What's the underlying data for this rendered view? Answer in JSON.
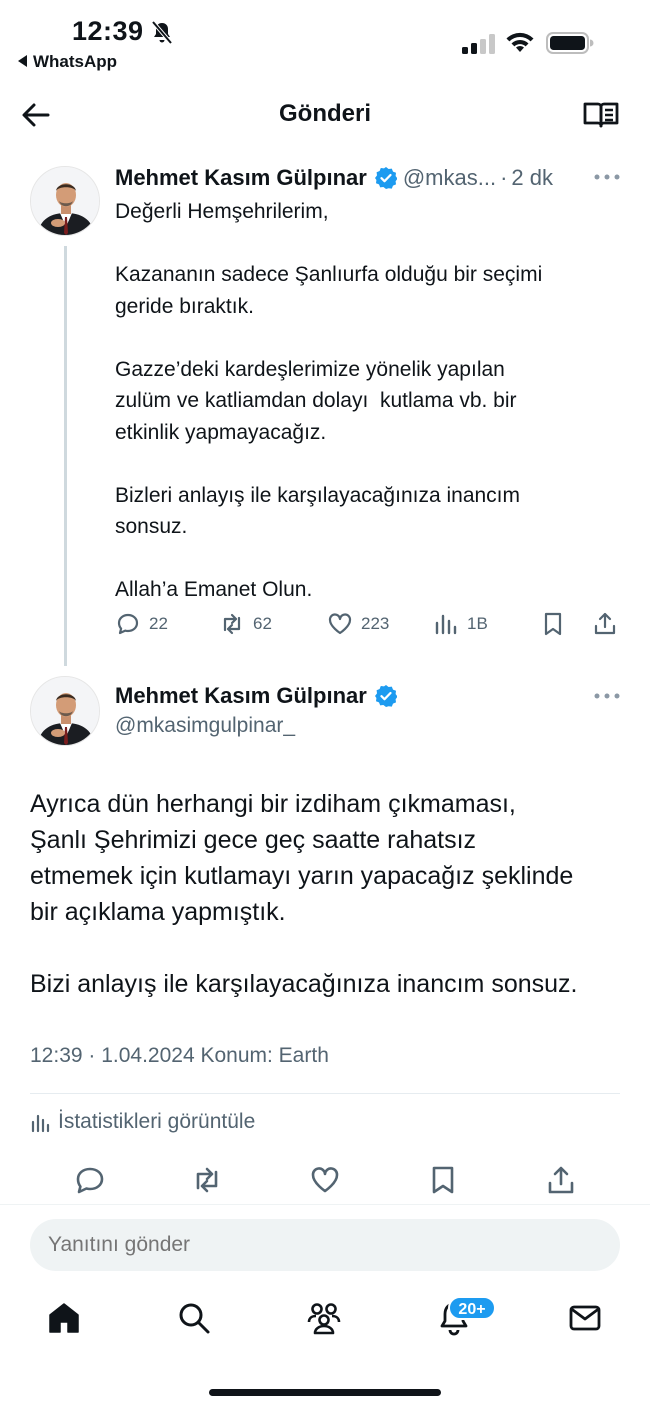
{
  "status_bar": {
    "time": "12:39",
    "back_app": "WhatsApp",
    "icons": [
      "bell-slash-icon",
      "signal-icon",
      "wifi-icon",
      "battery-icon"
    ]
  },
  "header": {
    "title": "Gönderi",
    "icons": [
      "back-arrow-icon",
      "reader-mode-icon"
    ]
  },
  "tweet_parent": {
    "name": "Mehmet Kasım Gülpınar",
    "handle": "@mkas...",
    "separator": "·",
    "ago": "2 dk",
    "body": "Değerli Hemşehrilerim,\n\nKazananın sadece Şanlıurfa olduğu bir seçimi\ngeride bıraktık.\n\nGazze’deki kardeşlerimize yönelik yapılan\nzulüm ve katliamdan dolayı  kutlama vb. bir\netkinlik yapmayacağız.\n\nBizleri anlayış ile karşılayacağınıza inancım\nsonsuz.\n\nAllah’a Emanet Olun.",
    "actions": {
      "replies": "22",
      "reposts": "62",
      "likes": "223",
      "views": "1B"
    }
  },
  "tweet_main": {
    "name": "Mehmet Kasım Gülpınar",
    "handle": "@mkasimgulpinar_",
    "body": "Ayrıca dün herhangi bir izdiham çıkmaması,\nŞanlı Şehrimizi gece geç saatte rahatsız\netmemek için kutlamayı yarın yapacağız şeklinde\nbir açıklama yapmıştık.\n\nBizi anlayış ile karşılayacağınıza inancım sonsuz.",
    "meta": "12:39 · 1.04.2024 Konum: Earth",
    "stats_label": "İstatistikleri görüntüle"
  },
  "reply": {
    "placeholder": "Yanıtını gönder"
  },
  "tabbar": {
    "items": [
      "home-icon",
      "search-icon",
      "communities-icon",
      "notifications-icon",
      "messages-icon"
    ],
    "notifications_badge": "20+"
  },
  "colors": {
    "accent": "#1d9bf0",
    "text": "#0f1419",
    "muted": "#536471"
  }
}
